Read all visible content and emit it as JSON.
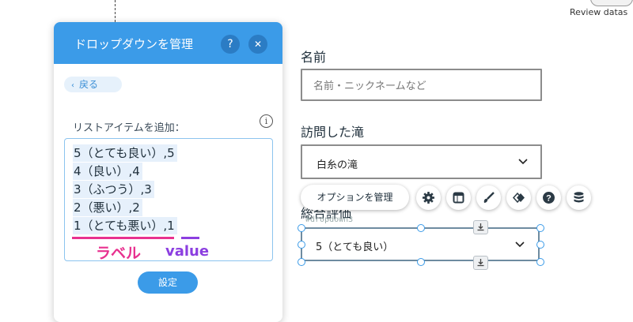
{
  "top": {
    "review_label": "Review datas"
  },
  "panel": {
    "title": "ドロップダウンを管理",
    "help_glyph": "?",
    "close_glyph": "✕",
    "back_label": "戻る",
    "list_label": "リストアイテムを追加：",
    "info_glyph": "i",
    "items": [
      "5（とても良い）,5",
      "4（良い）,4",
      "3（ふつう）,3",
      "2（悪い）,2",
      "1（とても悪い）,1"
    ],
    "annotations": {
      "label_text": "ラベル",
      "label_color": "#e8318f",
      "value_text": "value",
      "value_color": "#8c3fe0"
    },
    "set_button": "設定",
    "accent_color": "#3b9be8"
  },
  "form": {
    "name_label": "名前",
    "name_placeholder": "名前・ニックネームなど",
    "waterfall_label": "訪問した滝",
    "waterfall_value": "白糸の滝",
    "rating_label": "総合評価",
    "rating_component_id": "#dropdown3",
    "rating_value": "5（とても良い）"
  },
  "toolbar": {
    "manage_options_label": "オプションを管理",
    "icons": [
      "gear-icon",
      "layout-icon",
      "brush-icon",
      "animation-icon",
      "help-icon",
      "database-icon"
    ]
  }
}
